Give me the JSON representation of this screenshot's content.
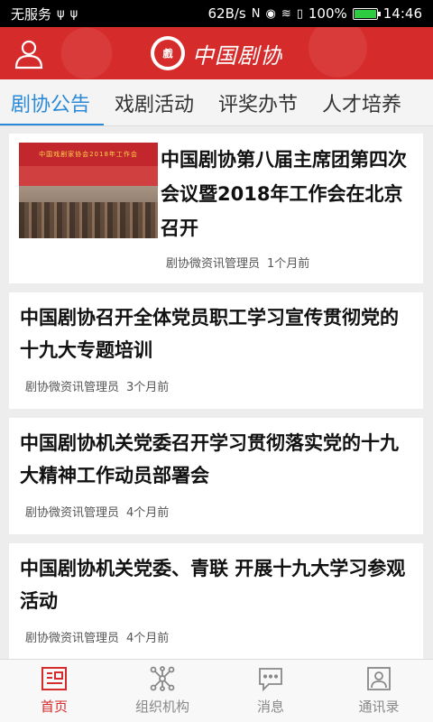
{
  "status_bar": {
    "carrier": "无服务",
    "speed": "62B/s",
    "battery_pct": "100%",
    "battery_level": 1.0,
    "time": "14:46"
  },
  "header": {
    "logo_text": "中国剧协",
    "emblem_text": "戲",
    "brand_color": "#d62b2b"
  },
  "tabs": [
    {
      "label": "剧协公告",
      "active": true
    },
    {
      "label": "戏剧活动",
      "active": false
    },
    {
      "label": "评奖办节",
      "active": false
    },
    {
      "label": "人才培养",
      "active": false
    }
  ],
  "accent_color": "#2a8ad8",
  "articles": [
    {
      "title": "中国剧协第八届主席团第四次会议暨2018年工作会在北京召开",
      "author": "剧协微资讯管理员",
      "time": "1个月前",
      "thumbnail_caption": "中国戏剧家协会2018年工作会"
    },
    {
      "title": "中国剧协召开全体党员职工学习宣传贯彻党的十九大专题培训",
      "author": "剧协微资讯管理员",
      "time": "3个月前"
    },
    {
      "title": "中国剧协机关党委召开学习贯彻落实党的十九大精神工作动员部署会",
      "author": "剧协微资讯管理员",
      "time": "4个月前"
    },
    {
      "title": "中国剧协机关党委、青联 开展十九大学习参观活动",
      "author": "剧协微资讯管理员",
      "time": "4个月前"
    }
  ],
  "bottom_nav": [
    {
      "label": "首页",
      "icon": "home-news-icon",
      "active": true
    },
    {
      "label": "组织机构",
      "icon": "org-structure-icon",
      "active": false
    },
    {
      "label": "消息",
      "icon": "message-icon",
      "active": false
    },
    {
      "label": "通讯录",
      "icon": "contacts-icon",
      "active": false
    }
  ]
}
